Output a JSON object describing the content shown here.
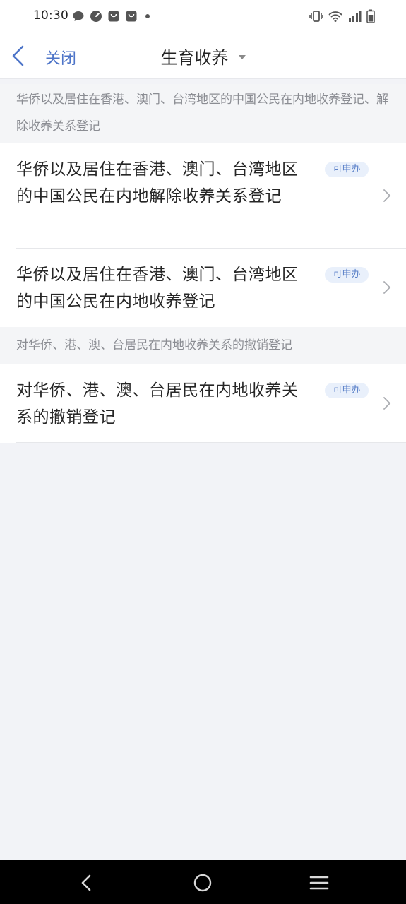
{
  "status_bar": {
    "time": "10:30",
    "left_icons": [
      "chat-bubble-icon",
      "gauge-icon",
      "bag-icon",
      "bag-icon",
      "dot-icon"
    ],
    "right_icons": [
      "vibrate-icon",
      "wifi-icon",
      "signal-icon",
      "battery-icon"
    ]
  },
  "nav": {
    "close_label": "关闭",
    "title": "生育收养"
  },
  "accent_color": "#4d74c8",
  "sections": [
    {
      "header": "华侨以及居住在香港、澳门、台湾地区的中国公民在内地收养登记、解除收养关系登记",
      "items": [
        {
          "text": "华侨以及居住在香港、澳门、台湾地区的中国公民在内地解除收养关系登记",
          "tag": "可申办"
        },
        {
          "text": "华侨以及居住在香港、澳门、台湾地区的中国公民在内地收养登记",
          "tag": "可申办"
        }
      ]
    },
    {
      "header": "对华侨、港、澳、台居民在内地收养关系的撤销登记",
      "items": [
        {
          "text": "对华侨、港、澳、台居民在内地收养关系的撤销登记",
          "tag": "可申办"
        }
      ]
    }
  ],
  "system_nav": [
    "back-icon",
    "home-icon",
    "recents-icon"
  ]
}
